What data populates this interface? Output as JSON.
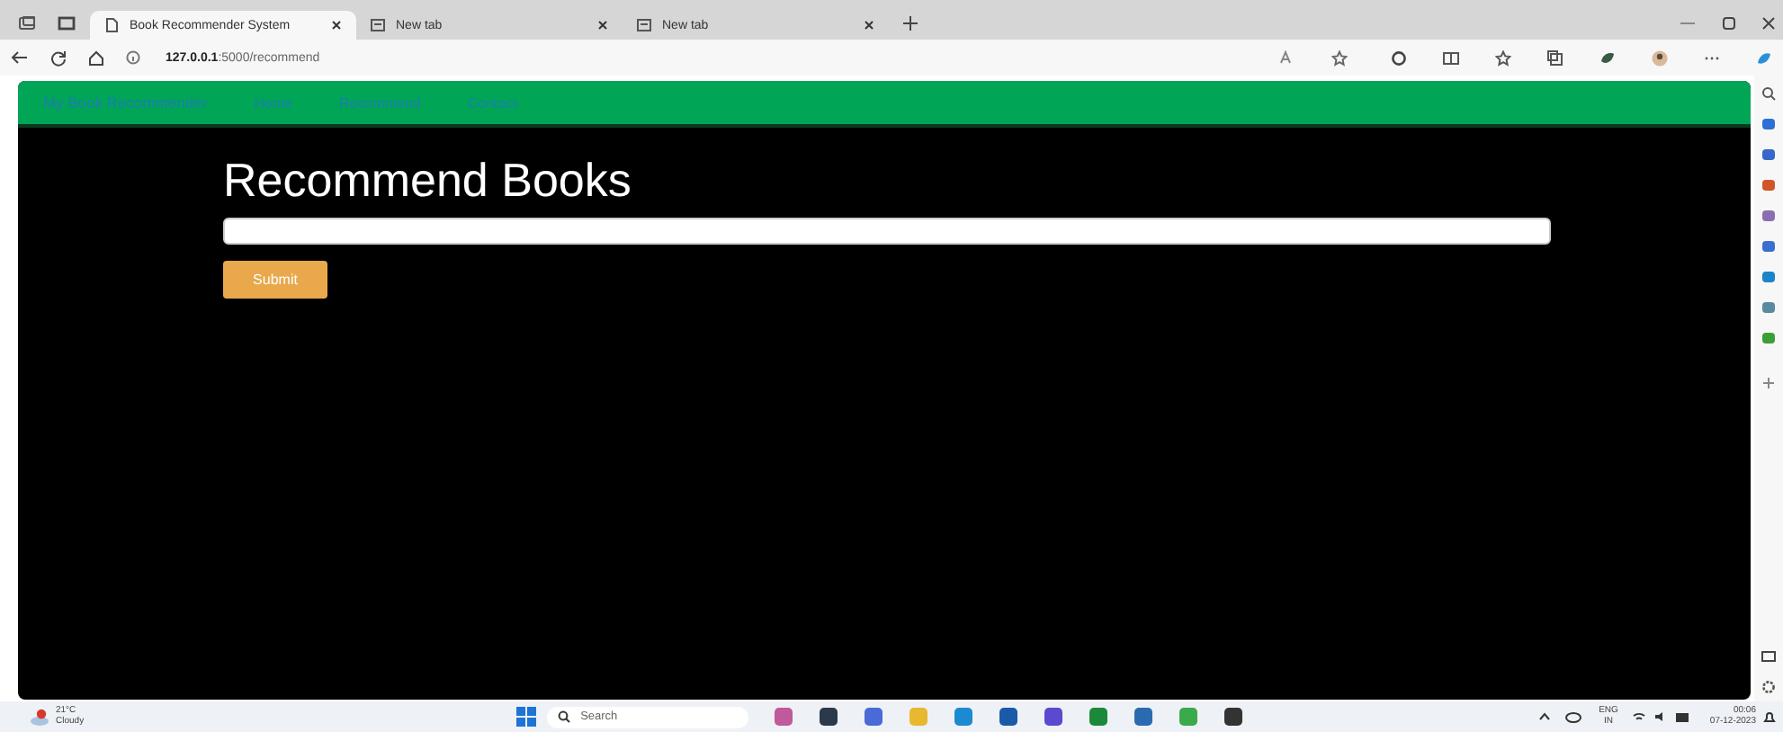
{
  "browser": {
    "tabs": [
      {
        "title": "Book Recommender System",
        "selected": true
      },
      {
        "title": "New tab",
        "selected": false
      },
      {
        "title": "New tab",
        "selected": false
      }
    ],
    "address": "**127.0.0.1**:5000/recommend"
  },
  "navbar": {
    "brand": "My Book Recommender",
    "links": [
      "Home",
      "Recommend",
      "Contact"
    ]
  },
  "page": {
    "heading": "Recommend Books",
    "button": "Submit"
  },
  "taskbar": {
    "weather": {
      "temp": "21°C",
      "condition": "Cloudy"
    },
    "search": {
      "placeholder": "Search"
    },
    "language": "ENG",
    "region": "IN",
    "time": "00:06",
    "date": "07-12-2023"
  }
}
